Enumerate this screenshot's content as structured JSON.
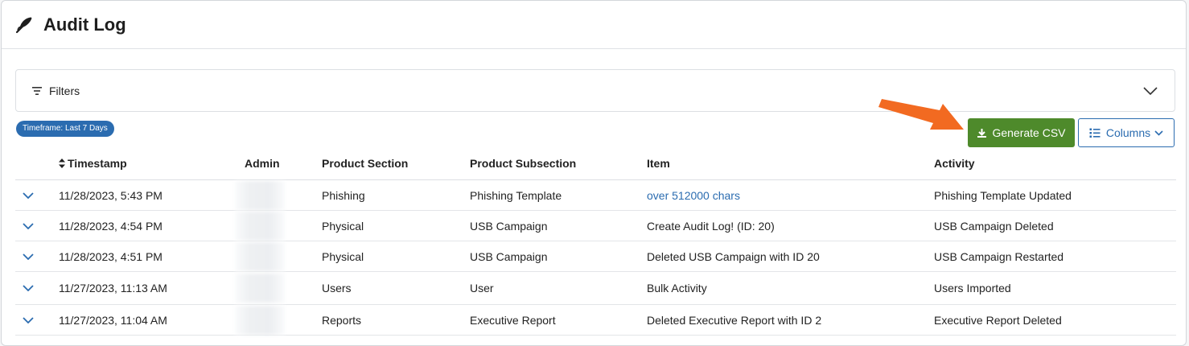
{
  "header": {
    "title": "Audit Log",
    "icon": "feather-pen-icon"
  },
  "filters": {
    "label": "Filters"
  },
  "timeframe_badge": "Timeframe: Last 7 Days",
  "toolbar": {
    "generate_csv_label": "Generate CSV",
    "columns_label": "Columns",
    "csv_color": "#4e8a2b",
    "accent_color": "#2b6cb0",
    "arrow_color": "#f26a21"
  },
  "table": {
    "columns": [
      "Timestamp",
      "Admin",
      "Product Section",
      "Product Subsection",
      "Item",
      "Activity"
    ],
    "rows": [
      {
        "timestamp": "11/28/2023, 5:43 PM",
        "admin": "",
        "section": "Phishing",
        "subsection": "Phishing Template",
        "item": "over 512000 chars",
        "activity": "Phishing Template Updated"
      },
      {
        "timestamp": "11/28/2023, 4:54 PM",
        "admin": "",
        "section": "Physical",
        "subsection": "USB Campaign",
        "item": "Create Audit Log! (ID: 20)",
        "activity": "USB Campaign Deleted"
      },
      {
        "timestamp": "11/28/2023, 4:51 PM",
        "admin": "",
        "section": "Physical",
        "subsection": "USB Campaign",
        "item": "Deleted USB Campaign with ID 20",
        "activity": "USB Campaign Restarted"
      },
      {
        "timestamp": "11/27/2023, 11:13 AM",
        "admin": "",
        "section": "Users",
        "subsection": "User",
        "item": "Bulk Activity",
        "activity": "Users Imported"
      },
      {
        "timestamp": "11/27/2023, 11:04 AM",
        "admin": "",
        "section": "Reports",
        "subsection": "Executive Report",
        "item": "Deleted Executive Report with ID 2",
        "activity": "Executive Report Deleted"
      }
    ]
  }
}
